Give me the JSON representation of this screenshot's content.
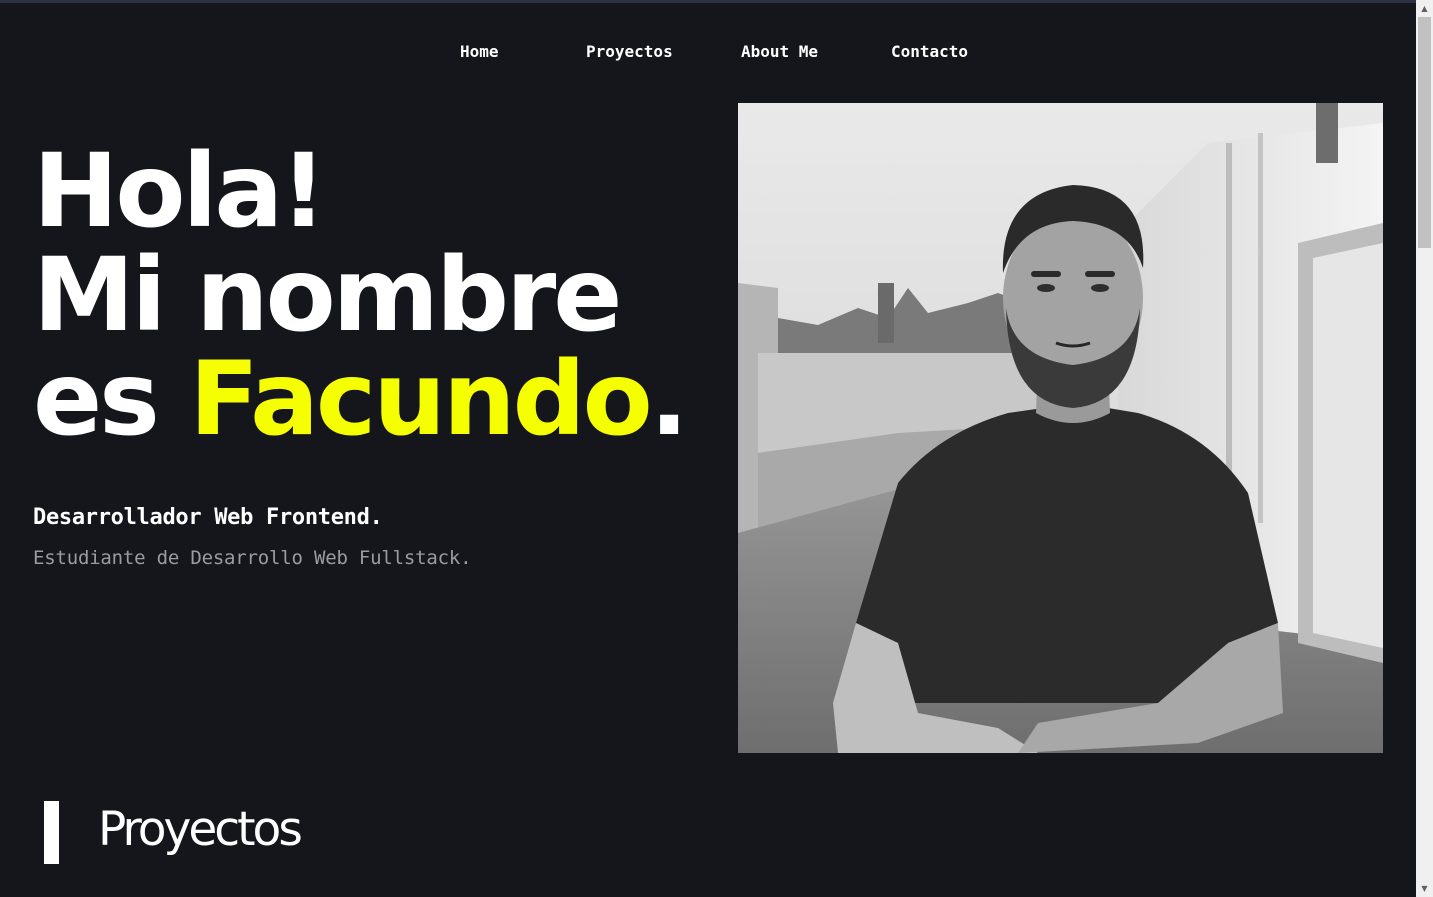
{
  "nav": {
    "items": [
      {
        "label": "Home"
      },
      {
        "label": "Proyectos"
      },
      {
        "label": "About Me"
      },
      {
        "label": "Contacto"
      }
    ]
  },
  "hero": {
    "line1": "Hola!",
    "line2": "Mi nombre",
    "line3_prefix": "es ",
    "name": "Facundo",
    "line3_suffix": ".",
    "role": "Desarrollador Web Frontend.",
    "study": "Estudiante de Desarrollo Web Fullstack.",
    "photo_icon": "portrait-photo"
  },
  "projects_section": {
    "title": "Proyectos"
  },
  "colors": {
    "background": "#14161c",
    "accent": "#f5ff00",
    "text": "#ffffff",
    "muted": "#9a9ca3"
  },
  "scrollbar": {
    "up_icon": "arrow-up-icon",
    "down_icon": "arrow-down-icon"
  }
}
